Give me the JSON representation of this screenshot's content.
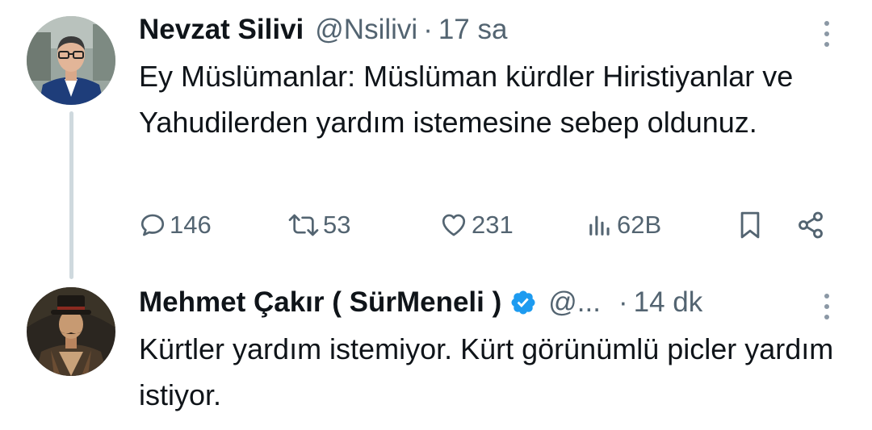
{
  "tweet_parent": {
    "author_name": "Nevzat Silivi",
    "handle": "@Nsilivi",
    "separator": "·",
    "time": "17 sa",
    "avatar_icon": "user-avatar-photo",
    "text": "Ey Müslümanlar: Müslüman kürdler Hiristiyanlar ve Yahudilerden yardım istemesine sebep oldunuz.",
    "actions": {
      "replies": "146",
      "reposts": "53",
      "likes": "231",
      "views": "62B"
    }
  },
  "tweet_reply": {
    "author_name": "Mehmet Çakır ( SürMeneli )",
    "verified": true,
    "handle": "@...",
    "separator": "·",
    "time": "14 dk",
    "avatar_icon": "user-avatar-illustration",
    "text": "Kürtler yardım istemiyor. Kürt görünümlü picler yardım istiyor."
  },
  "colors": {
    "text_primary": "#0f1419",
    "text_secondary": "#536471",
    "thread_line": "#cfd9de",
    "verified_blue": "#1d9bf0"
  }
}
